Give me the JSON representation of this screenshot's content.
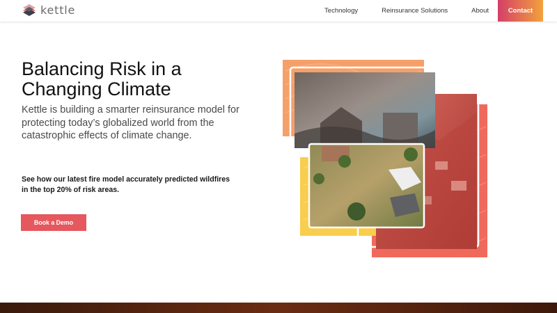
{
  "header": {
    "logo_text": "kettle",
    "nav": {
      "technology": "Technology",
      "reinsurance": "Reinsurance Solutions",
      "about": "About",
      "contact": "Contact"
    }
  },
  "hero": {
    "title_line1": "Balancing Risk in a",
    "title_line2": "Changing Climate",
    "subtitle": "Kettle is building a smarter reinsurance model for protecting today’s globalized world from the catastrophic effects of climate change.",
    "note": "See how our latest fire model accurately predicted wildfires in the top 20% of risk areas.",
    "cta": "Book a Demo"
  },
  "colors": {
    "cta": "#e5585e",
    "contact_gradient_start": "#d43f67",
    "contact_gradient_end": "#f2a23c",
    "orange_card": "#f5a06a",
    "yellow_card": "#f9cd4d",
    "red_card": "#f06a5c"
  },
  "icons": {
    "logo": "kettle-layered-diamond-logo"
  }
}
